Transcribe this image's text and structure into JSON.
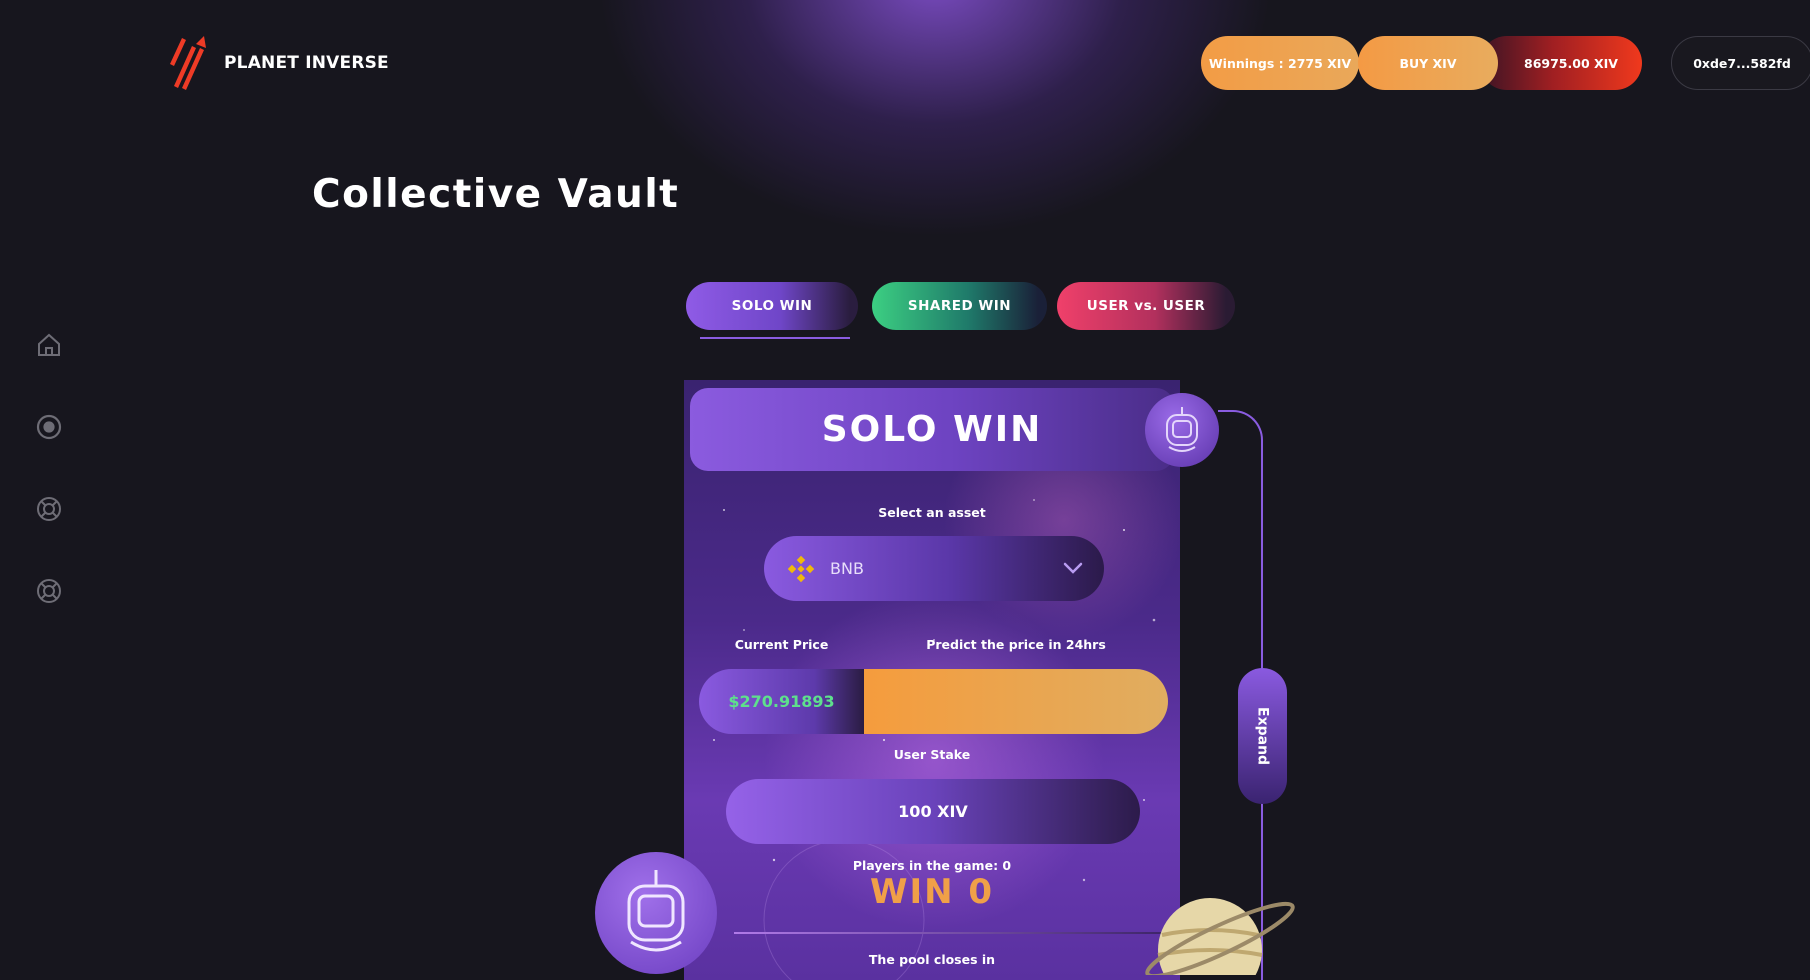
{
  "header": {
    "brand": "PLANET INVERSE",
    "winnings": "Winnings : 2775 XIV",
    "buy": "BUY XIV",
    "balance": "86975.00 XIV",
    "wallet": "0xde7...582fd"
  },
  "sidebar": {
    "items": [
      {
        "icon": "home-icon"
      },
      {
        "icon": "target-icon"
      },
      {
        "icon": "lifebuoy-icon"
      },
      {
        "icon": "lifebuoy-icon"
      }
    ]
  },
  "page": {
    "title": "Collective Vault"
  },
  "tabs": [
    {
      "label": "SOLO WIN",
      "active": true
    },
    {
      "label": "SHARED WIN",
      "active": false
    },
    {
      "label": "USER vs. USER",
      "active": false
    }
  ],
  "card": {
    "title": "SOLO WIN",
    "select_label": "Select an asset",
    "asset": "BNB",
    "current_price_label": "Current Price",
    "predict_label": "Predict the price in 24hrs",
    "current_price": "$270.91893",
    "predict_value": "",
    "stake_label": "User Stake",
    "stake": "100 XIV",
    "players": "Players in the game: 0",
    "win": "WIN 0",
    "pool_closes": "The pool closes in"
  },
  "expand": "Expand",
  "colors": {
    "accent_purple": "#8a5ce0",
    "accent_orange": "#f39c45",
    "price_green": "#5ee08c",
    "balance_red": "#f0391d"
  }
}
